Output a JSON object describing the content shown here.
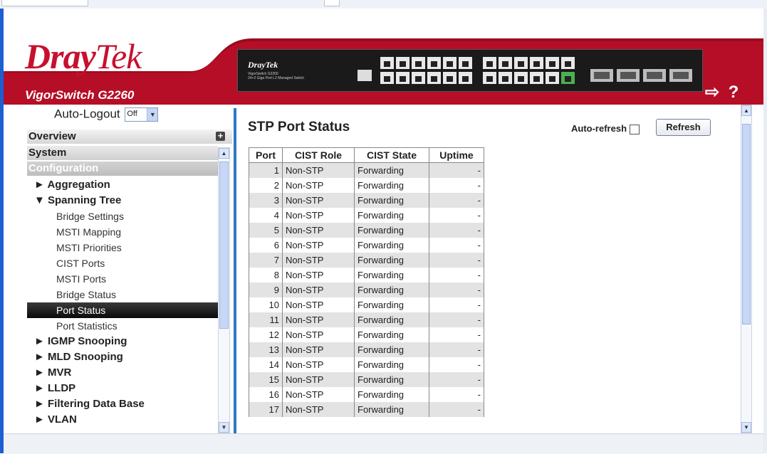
{
  "header": {
    "brand": "Dray",
    "brand2": "Tek",
    "model": "VigorSwitch G2260",
    "device_brand": "DrayTek",
    "device_model": "VigorSwitch G2260",
    "device_sub": "24+2 Giga Port L2 Managed Switch",
    "colors": {
      "brand_red": "#c8102e"
    }
  },
  "nav": {
    "autologout_label": "Auto-Logout",
    "autologout_value": "Off",
    "overview": "Overview",
    "system": "System",
    "configuration": "Configuration",
    "items": [
      {
        "label": "► Aggregation",
        "level": 1
      },
      {
        "label": "▼ Spanning Tree",
        "level": 1
      },
      {
        "label": "Bridge Settings",
        "level": 2
      },
      {
        "label": "MSTI Mapping",
        "level": 2
      },
      {
        "label": "MSTI Priorities",
        "level": 2
      },
      {
        "label": "CIST Ports",
        "level": 2
      },
      {
        "label": "MSTI Ports",
        "level": 2
      },
      {
        "label": "Bridge Status",
        "level": 2
      },
      {
        "label": "Port Status",
        "level": 2,
        "active": true
      },
      {
        "label": "Port Statistics",
        "level": 2
      },
      {
        "label": "► IGMP Snooping",
        "level": 1
      },
      {
        "label": "► MLD Snooping",
        "level": 1
      },
      {
        "label": "► MVR",
        "level": 1
      },
      {
        "label": "► LLDP",
        "level": 1
      },
      {
        "label": "► Filtering Data Base",
        "level": 1
      },
      {
        "label": "► VLAN",
        "level": 1
      }
    ]
  },
  "main": {
    "title": "STP Port Status",
    "autorefresh_label": "Auto-refresh",
    "refresh_label": "Refresh",
    "columns": [
      "Port",
      "CIST Role",
      "CIST State",
      "Uptime"
    ],
    "rows": [
      [
        "1",
        "Non-STP",
        "Forwarding",
        "-"
      ],
      [
        "2",
        "Non-STP",
        "Forwarding",
        "-"
      ],
      [
        "3",
        "Non-STP",
        "Forwarding",
        "-"
      ],
      [
        "4",
        "Non-STP",
        "Forwarding",
        "-"
      ],
      [
        "5",
        "Non-STP",
        "Forwarding",
        "-"
      ],
      [
        "6",
        "Non-STP",
        "Forwarding",
        "-"
      ],
      [
        "7",
        "Non-STP",
        "Forwarding",
        "-"
      ],
      [
        "8",
        "Non-STP",
        "Forwarding",
        "-"
      ],
      [
        "9",
        "Non-STP",
        "Forwarding",
        "-"
      ],
      [
        "10",
        "Non-STP",
        "Forwarding",
        "-"
      ],
      [
        "11",
        "Non-STP",
        "Forwarding",
        "-"
      ],
      [
        "12",
        "Non-STP",
        "Forwarding",
        "-"
      ],
      [
        "13",
        "Non-STP",
        "Forwarding",
        "-"
      ],
      [
        "14",
        "Non-STP",
        "Forwarding",
        "-"
      ],
      [
        "15",
        "Non-STP",
        "Forwarding",
        "-"
      ],
      [
        "16",
        "Non-STP",
        "Forwarding",
        "-"
      ],
      [
        "17",
        "Non-STP",
        "Forwarding",
        "-"
      ]
    ]
  }
}
